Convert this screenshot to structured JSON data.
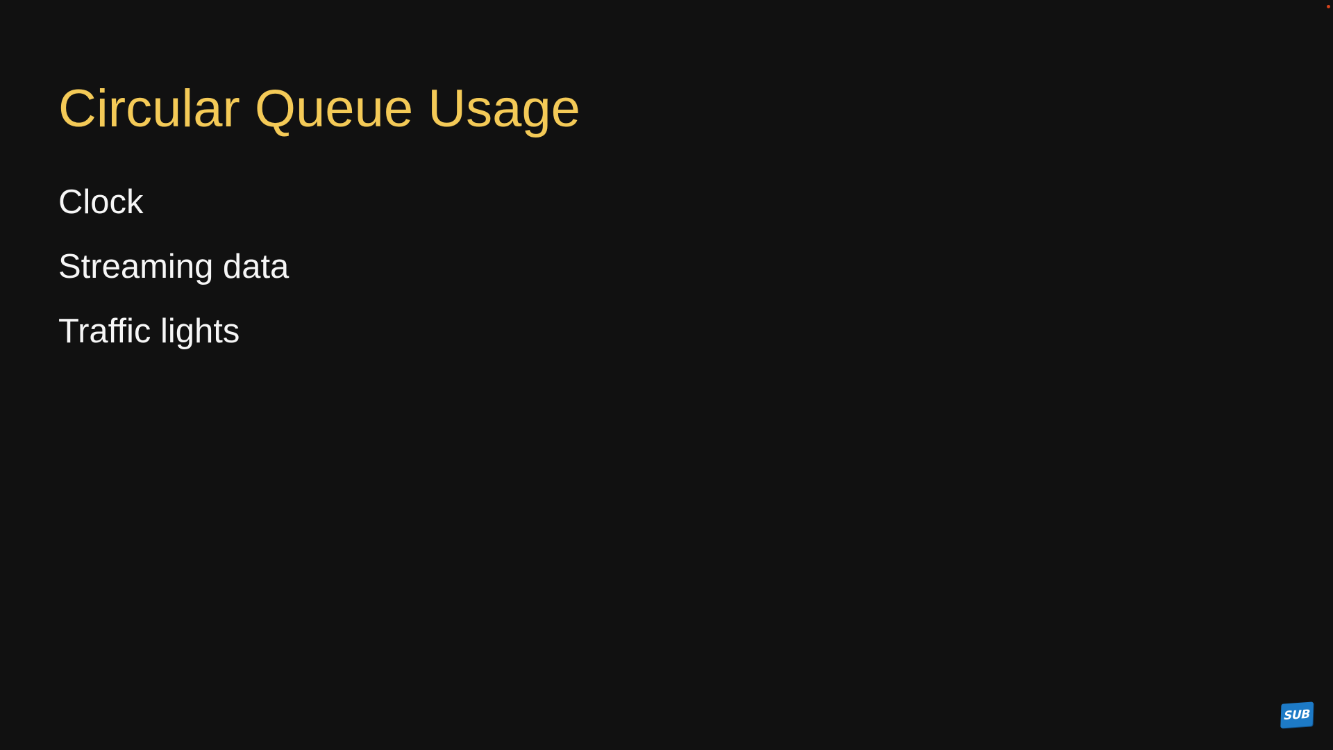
{
  "slide": {
    "title": "Circular Queue Usage",
    "bullets": [
      "Clock",
      "Streaming data",
      "Traffic lights"
    ]
  },
  "badge": {
    "label": "SUB",
    "icon": "subscribe-badge-icon",
    "color": "#1d7ac6"
  },
  "colors": {
    "background": "#111111",
    "title": "#f4ca57",
    "text": "#f6f6f6",
    "corner_dot": "#d4431c"
  }
}
